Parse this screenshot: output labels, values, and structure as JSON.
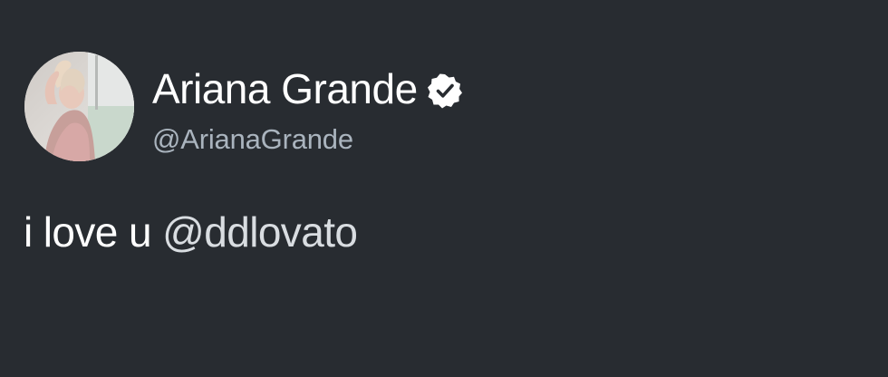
{
  "tweet": {
    "author": {
      "display_name": "Ariana Grande",
      "handle": "@ArianaGrande",
      "verified": true,
      "avatar_icon": "profile-photo"
    },
    "text": {
      "prefix": "i love u ",
      "mention": "@ddlovato"
    },
    "colors": {
      "background": "#282c31",
      "name": "#ffffff",
      "handle": "#aab4be",
      "text": "#ffffff"
    }
  }
}
